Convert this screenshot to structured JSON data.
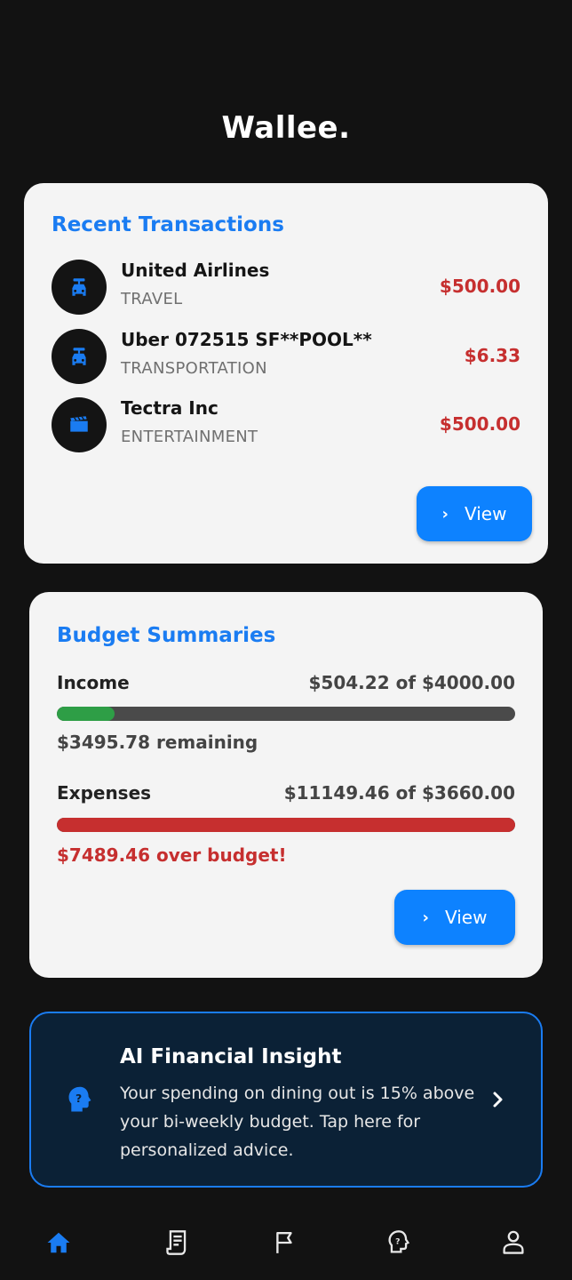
{
  "app": {
    "title": "Wallee."
  },
  "transactions": {
    "title": "Recent Transactions",
    "items": [
      {
        "name": "United Airlines",
        "category": "TRAVEL",
        "amount": "$500.00",
        "icon": "car-icon"
      },
      {
        "name": "Uber 072515 SF**POOL**",
        "category": "TRANSPORTATION",
        "amount": "$6.33",
        "icon": "car-icon"
      },
      {
        "name": "Tectra Inc",
        "category": "ENTERTAINMENT",
        "amount": "$500.00",
        "icon": "movie-icon"
      }
    ],
    "view_label": "View"
  },
  "budget": {
    "title": "Budget Summaries",
    "income": {
      "label": "Income",
      "value": "$504.22 of $4000.00",
      "progress": 0.126,
      "note": "$3495.78 remaining",
      "bar_color": "#2e9e46"
    },
    "expenses": {
      "label": "Expenses",
      "value": "$11149.46 of $3660.00",
      "progress": 1.0,
      "note": "$7489.46 over budget!",
      "bar_color": "#c62f2f"
    },
    "view_label": "View"
  },
  "insight": {
    "title": "AI Financial Insight",
    "body": "Your spending on dining out is 15% above your bi-weekly budget. Tap here for personalized advice.",
    "icon": "ai-head-icon"
  },
  "nav": {
    "items": [
      {
        "name": "home-icon",
        "active": true
      },
      {
        "name": "receipt-icon",
        "active": false
      },
      {
        "name": "flag-icon",
        "active": false
      },
      {
        "name": "advisor-icon",
        "active": false
      },
      {
        "name": "profile-icon",
        "active": false
      }
    ],
    "active_color": "#1a7cf2",
    "inactive_color": "#e8e8e8"
  },
  "colors": {
    "accent": "#1a7cf2",
    "negative": "#c62f2f",
    "button": "#0d82ff"
  }
}
